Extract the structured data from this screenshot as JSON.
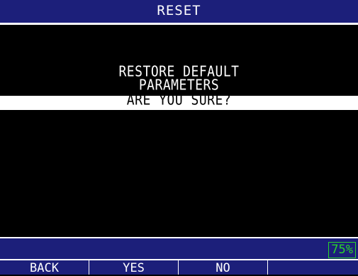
{
  "header": {
    "title": "RESET"
  },
  "dialog": {
    "line1": "RESTORE DEFAULT",
    "line2": "PARAMETERS",
    "confirm": "ARE YOU SURE?"
  },
  "status": {
    "battery": "75%"
  },
  "softkeys": [
    {
      "label": "BACK"
    },
    {
      "label": "YES"
    },
    {
      "label": "NO"
    },
    {
      "label": ""
    }
  ],
  "colors": {
    "bar_background": "#1c1f7a",
    "screen_background": "#000000",
    "text": "#ffffff",
    "battery": "#2ad42a"
  }
}
